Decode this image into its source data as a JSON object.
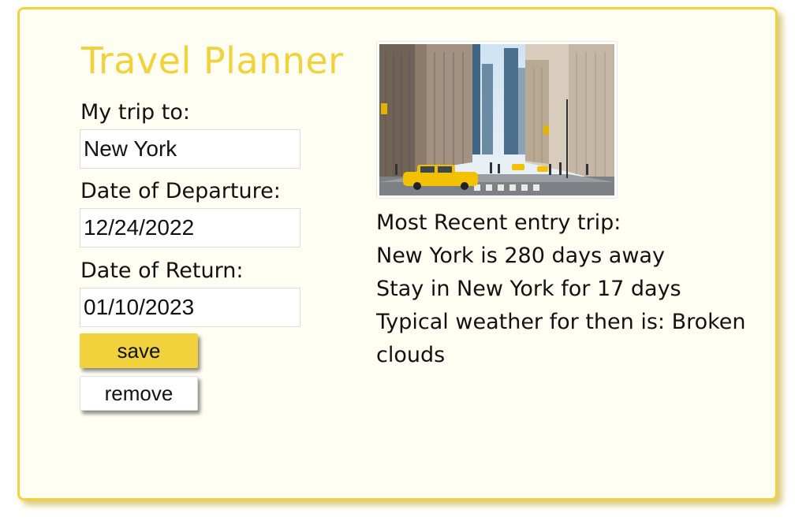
{
  "app": {
    "title": "Travel Planner"
  },
  "form": {
    "destination_label": "My trip to:",
    "destination_value": "New York",
    "departure_label": "Date of Departure:",
    "departure_value": "12/24/2022",
    "return_label": "Date of Return:",
    "return_value": "01/10/2023",
    "save_label": "save",
    "remove_label": "remove"
  },
  "entry": {
    "heading": "Most Recent entry trip:",
    "countdown": "New York is 280 days away",
    "duration": "Stay in New York for 17 days",
    "weather": "Typical weather for then is: Broken clouds",
    "image_subject": "new-york-street-photo"
  },
  "colors": {
    "accent": "#f2d23c",
    "background": "#fffef3",
    "text": "#111111"
  }
}
